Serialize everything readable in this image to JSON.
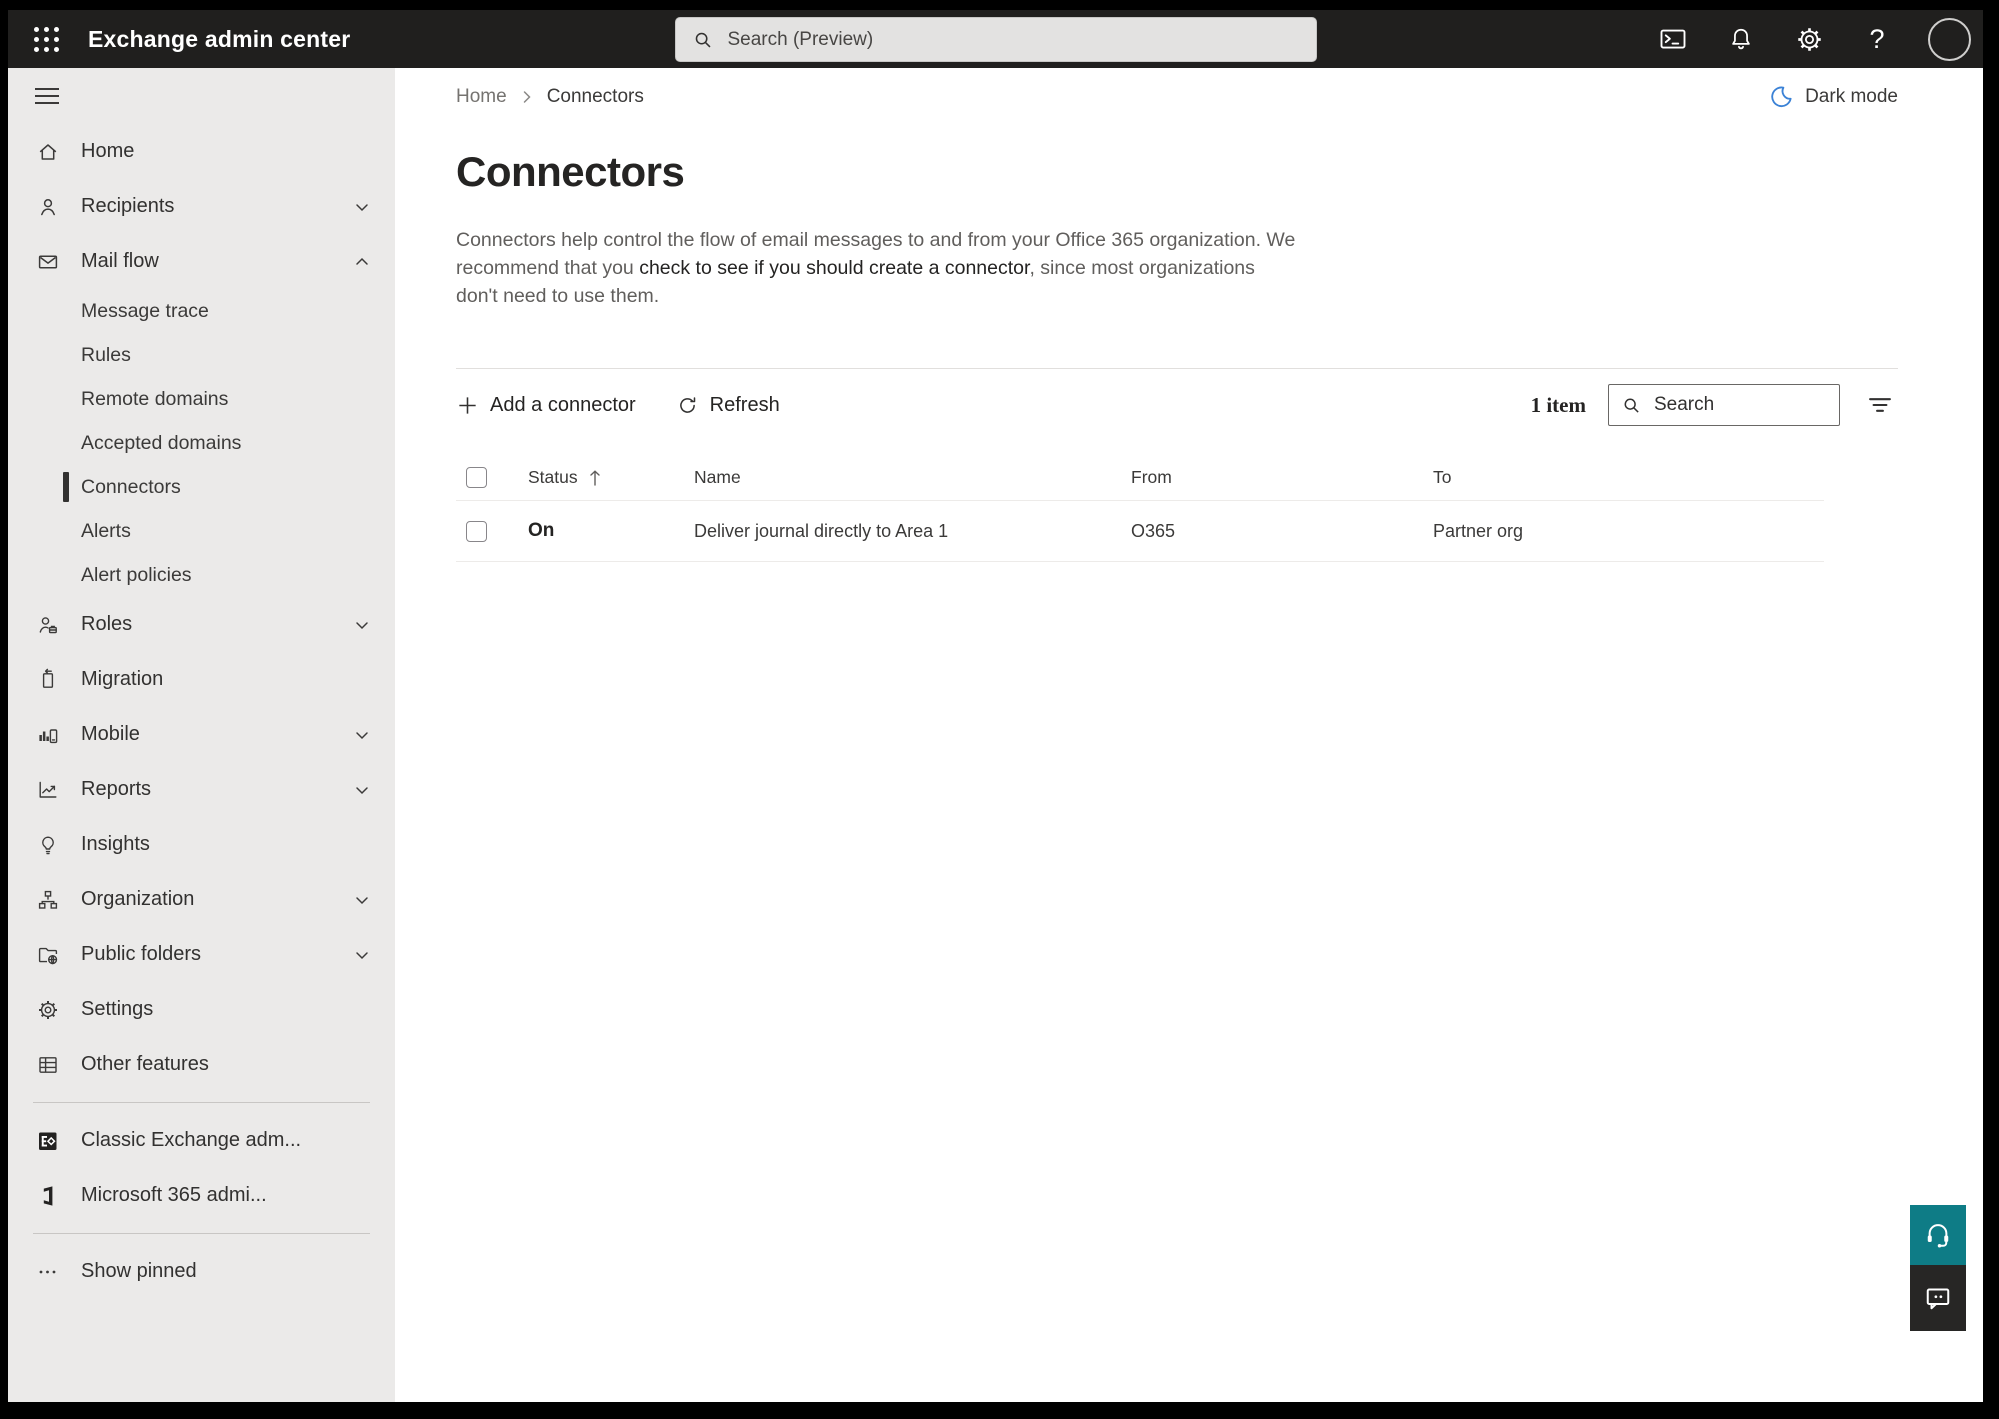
{
  "colors": {
    "topbar_bg": "#201f1e",
    "sidebar_bg": "#ebeae9",
    "accent_teal": "#0e7c86",
    "chat_button_bg": "#272625",
    "moon_blue": "#3b82d6",
    "text_dark": "#252423",
    "text_gray": "#605e5c",
    "selected_indicator": "#323130"
  },
  "topbar": {
    "title": "Exchange admin center",
    "search_placeholder": "Search (Preview)"
  },
  "breadcrumb": {
    "home": "Home",
    "current": "Connectors"
  },
  "dark_mode": {
    "label": "Dark mode"
  },
  "page": {
    "title": "Connectors",
    "desc_pre": "Connectors help control the flow of email messages to and from your Office 365 organization. We recommend that you ",
    "desc_link": "check to see if you should create a connector",
    "desc_post": ", since most organizations don't need to use them."
  },
  "toolbar": {
    "add_label": "Add a connector",
    "refresh_label": "Refresh",
    "item_count": "1 item",
    "search_placeholder": "Search"
  },
  "table": {
    "headers": {
      "status": "Status",
      "name": "Name",
      "from": "From",
      "to": "To"
    },
    "rows": [
      {
        "status": "On",
        "name": "Deliver journal directly to Area 1",
        "from": "O365",
        "to": "Partner org"
      }
    ]
  },
  "sidebar": {
    "items": [
      {
        "label": "Home"
      },
      {
        "label": "Recipients"
      },
      {
        "label": "Mail flow"
      },
      {
        "label": "Message trace"
      },
      {
        "label": "Rules"
      },
      {
        "label": "Remote domains"
      },
      {
        "label": "Accepted domains"
      },
      {
        "label": "Connectors"
      },
      {
        "label": "Alerts"
      },
      {
        "label": "Alert policies"
      },
      {
        "label": "Roles"
      },
      {
        "label": "Migration"
      },
      {
        "label": "Mobile"
      },
      {
        "label": "Reports"
      },
      {
        "label": "Insights"
      },
      {
        "label": "Organization"
      },
      {
        "label": "Public folders"
      },
      {
        "label": "Settings"
      },
      {
        "label": "Other features"
      },
      {
        "label": "Classic Exchange adm..."
      },
      {
        "label": "Microsoft 365 admi..."
      },
      {
        "label": "Show pinned"
      }
    ]
  },
  "icons": {
    "app-launcher-icon": "3x3 white dot grid",
    "terminal-icon": "console window with prompt",
    "bell-icon": "notification bell outline",
    "gear-icon": "settings gear outline",
    "help-icon": "?",
    "avatar": "circle account photo",
    "search-icon": "magnifier",
    "hamburger-icon": "three lines",
    "moon-icon": "blue crescent",
    "plus-icon": "+",
    "refresh-icon": "circular arrow",
    "filter-icon": "three decreasing lines",
    "sort-up-icon": "up arrow",
    "headset-icon": "support headset",
    "chat-icon": "speech bubble with dots"
  }
}
